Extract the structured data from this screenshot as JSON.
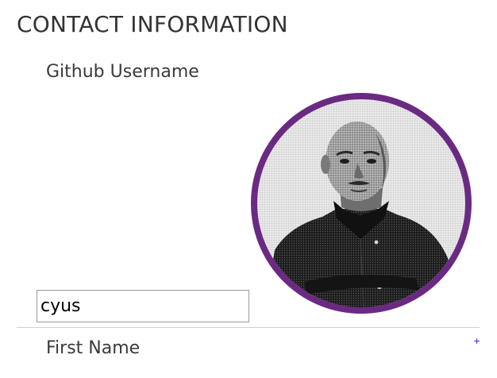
{
  "section": {
    "title": "CONTACT INFORMATION"
  },
  "fields": {
    "github_username": {
      "label": "Github Username",
      "value": "cyus"
    },
    "first_name": {
      "label": "First Name",
      "add_label": "+"
    }
  },
  "avatar": {
    "ring_color": "#6b2a82"
  }
}
